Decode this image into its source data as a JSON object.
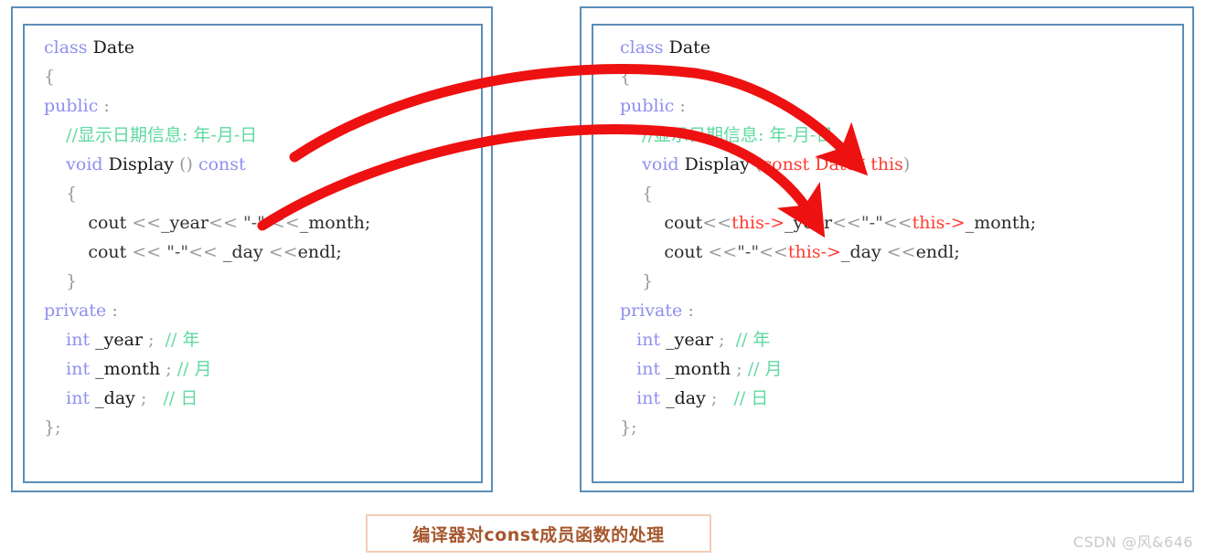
{
  "caption": {
    "text": "编译器对const成员函数的处理"
  },
  "watermark": {
    "text": "CSDN @风&646"
  },
  "colors": {
    "panel_border": "#5b8db8",
    "arrow": "#ee1111",
    "keyword": "#8f8ff0",
    "comment": "#5fd9a0",
    "this_pointer": "#ff3b30",
    "caption_text": "#a6572e",
    "caption_border": "#f3cdb6",
    "watermark": "#c9c9c9"
  },
  "left_panel": {
    "title": "original-const-member-function",
    "lines": [
      "class Date",
      "{",
      "public :",
      "    //显示日期信息: 年-月-日",
      "    void Display () const",
      "    {",
      "        cout <<_year<< \"-\" <<_month;",
      "        cout << \"-\"<< _day <<endl;",
      "    }",
      "private :",
      "    int _year ;  // 年",
      "    int _month ; // 月",
      "    int _day ;   // 日",
      "};"
    ]
  },
  "right_panel": {
    "title": "compiler-transformed-with-this-pointer",
    "lines": [
      "class Date",
      "{",
      "public :",
      "    //显示日期信息: 年-月-日",
      "    void Display (const Date* this)",
      "    {",
      "        cout<<this->_year<<\"-\"<<this->_month;",
      "        cout <<\"-\"<<this->_day <<endl;",
      "    }",
      "private :",
      "    int _year ;  // 年",
      "    int _month ; // 月",
      "    int _day ;   // 日",
      "};"
    ]
  },
  "arrows": [
    {
      "name": "arrow-const-to-this-param",
      "from": "void Display () const",
      "to": "void Display (const Date* this)"
    },
    {
      "name": "arrow-members-to-this-members",
      "from": "cout <<_year<< \"-\" <<_month;",
      "to": "cout<<this->_year<<\"-\"<<this->_month;"
    }
  ]
}
